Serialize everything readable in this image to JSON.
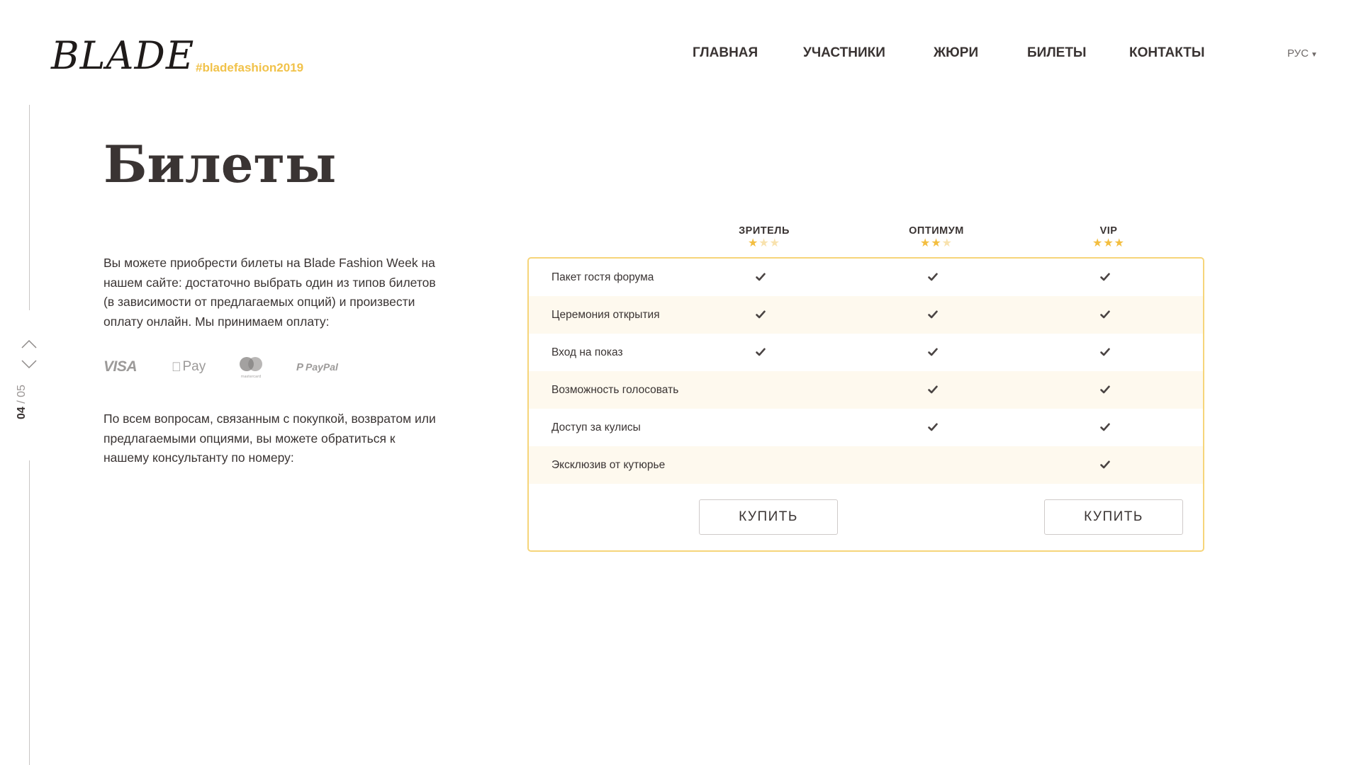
{
  "header": {
    "logo": "BLADE",
    "hashtag": "#bladefashion2019",
    "nav": [
      {
        "label": "ГЛАВНАЯ",
        "active": false
      },
      {
        "label": "УЧАСТНИКИ",
        "active": false
      },
      {
        "label": "ЖЮРИ",
        "active": false
      },
      {
        "label": "БИЛЕТЫ",
        "active": true
      },
      {
        "label": "КОНТАКТЫ",
        "active": false
      }
    ],
    "language": "РУС"
  },
  "pager": {
    "current": "04",
    "separator": "/",
    "total": "05"
  },
  "main": {
    "title": "Билеты",
    "intro": "Вы можете приобрести билеты на Blade Fashion Week на нашем сайте: достаточно выбрать один из типов билетов (в зависимости от предлагаемых опций) и произвести оплату онлайн. Мы принимаем оплату:",
    "payment_methods": [
      "VISA",
      "Pay",
      "mastercard",
      "PayPal"
    ],
    "contact": "По всем вопросам, связанным с покупкой, возвратом или предлагаемыми опциями, вы можете обратиться к нашему консультанту по номеру:"
  },
  "tickets": {
    "tiers": [
      {
        "name": "ЗРИТЕЛЬ",
        "stars": 1,
        "max_stars": 3
      },
      {
        "name": "ОПТИМУМ",
        "stars": 2,
        "max_stars": 3
      },
      {
        "name": "VIP",
        "stars": 3,
        "max_stars": 3
      }
    ],
    "features": [
      {
        "label": "Пакет гостя форума",
        "included": [
          true,
          true,
          true
        ]
      },
      {
        "label": "Церемония открытия",
        "included": [
          true,
          true,
          true
        ]
      },
      {
        "label": "Вход на показ",
        "included": [
          true,
          true,
          true
        ]
      },
      {
        "label": "Возможность голосовать",
        "included": [
          false,
          true,
          true
        ]
      },
      {
        "label": " Доступ за кулисы",
        "included": [
          false,
          true,
          true
        ]
      },
      {
        "label": "Эксклюзив от кутюрье",
        "included": [
          false,
          false,
          true
        ]
      }
    ],
    "buy_buttons": [
      {
        "label": "КУПИТЬ",
        "tier": 0
      },
      {
        "label": "КУПИТЬ",
        "tier": 2
      }
    ]
  },
  "colors": {
    "accent": "#f6c85a",
    "star_on": "#f3be40",
    "star_off": "#f8e2ae",
    "table_border": "#f6d57a",
    "row_alt": "#fef9ee",
    "text": "#3a3433"
  }
}
